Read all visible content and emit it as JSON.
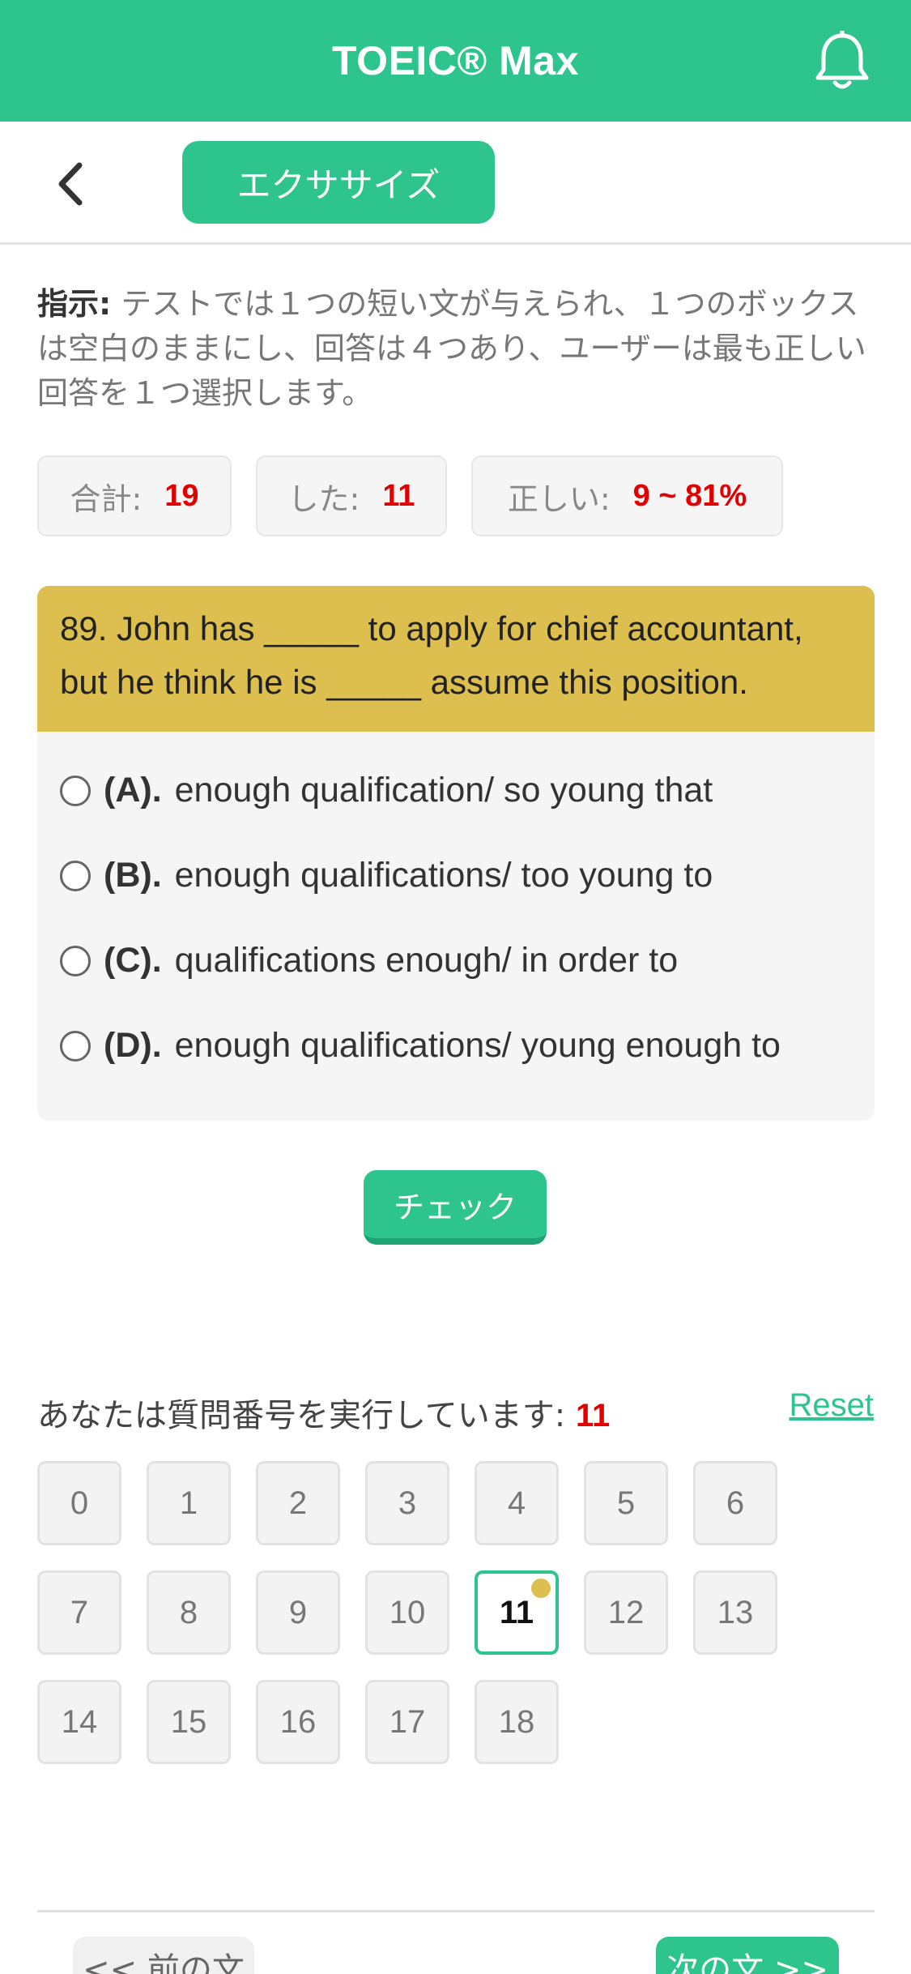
{
  "header": {
    "title": "TOEIC® Max",
    "bell_icon": "bell-icon"
  },
  "toolbar": {
    "back_icon": "chevron-left-icon",
    "tab_label": "エクササイズ"
  },
  "instructions": {
    "label": "指示:",
    "text": " テストでは１つの短い文が与えられ、１つのボックスは空白のままにし、回答は４つあり、ユーザーは最も正しい回答を１つ選択します。"
  },
  "stats": {
    "total_label": "合計:",
    "total_value": "19",
    "done_label": "した:",
    "done_value": "11",
    "correct_label": "正しい:",
    "correct_value": "9 ~ 81%"
  },
  "question": {
    "text": "89. John has _____ to apply for chief accountant, but he think he is _____ assume this position.",
    "options": [
      {
        "letter": "(A).",
        "text": "enough qualification/ so young that"
      },
      {
        "letter": "(B).",
        "text": "enough qualifications/ too young to"
      },
      {
        "letter": "(C).",
        "text": "qualifications enough/ in order to"
      },
      {
        "letter": "(D).",
        "text": "enough qualifications/ young enough to"
      }
    ]
  },
  "check_label": "チェック",
  "progress": {
    "label": "あなたは質問番号を実行しています:",
    "current": "11",
    "reset_label": "Reset",
    "numbers": [
      "0",
      "1",
      "2",
      "3",
      "4",
      "5",
      "6",
      "7",
      "8",
      "9",
      "10",
      "11",
      "12",
      "13",
      "14",
      "15",
      "16",
      "17",
      "18"
    ]
  },
  "footer": {
    "prev_label": "<< 前の文",
    "next_label": "次の文 >>"
  },
  "colors": {
    "accent": "#2dc48d",
    "question_bg": "#dcbf4e",
    "highlight": "#e00000"
  }
}
